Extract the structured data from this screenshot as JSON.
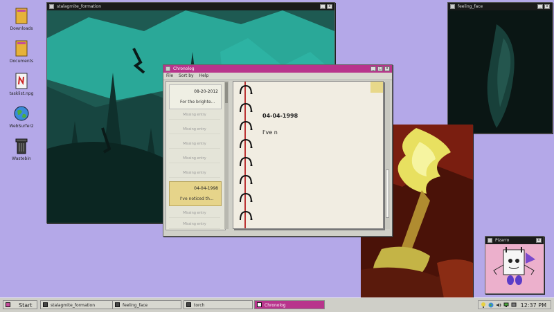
{
  "desktop_icons": [
    {
      "label": "Downloads"
    },
    {
      "label": "Documents"
    },
    {
      "label": "tasklist.npg"
    },
    {
      "label": "WebSurfer2"
    },
    {
      "label": "Wastebin"
    }
  ],
  "windows": {
    "stalagmite": {
      "title": "stalagmite_formation"
    },
    "feeling": {
      "title": "feeling_face"
    },
    "pizarro": {
      "title": "Pizarro"
    }
  },
  "chronolog": {
    "title": "Chronolog",
    "menu": [
      "File",
      "Sort by",
      "Help"
    ],
    "entries": [
      {
        "date": "08-20-2012",
        "preview": "For the brighte..."
      },
      {
        "date": "04-04-1998",
        "preview": "I've noticed th..."
      }
    ],
    "missing_label": "Missing entry",
    "page": {
      "date": "04-04-1998",
      "text": "I've n"
    }
  },
  "taskbar": {
    "start": "Start",
    "tasks": [
      "stalagmite_formation",
      "feeling_face",
      "torch",
      "Chronolog"
    ],
    "clock": "12:37 PM"
  },
  "colors": {
    "accent": "#b8348c",
    "desktop": "#b4a8e8"
  }
}
